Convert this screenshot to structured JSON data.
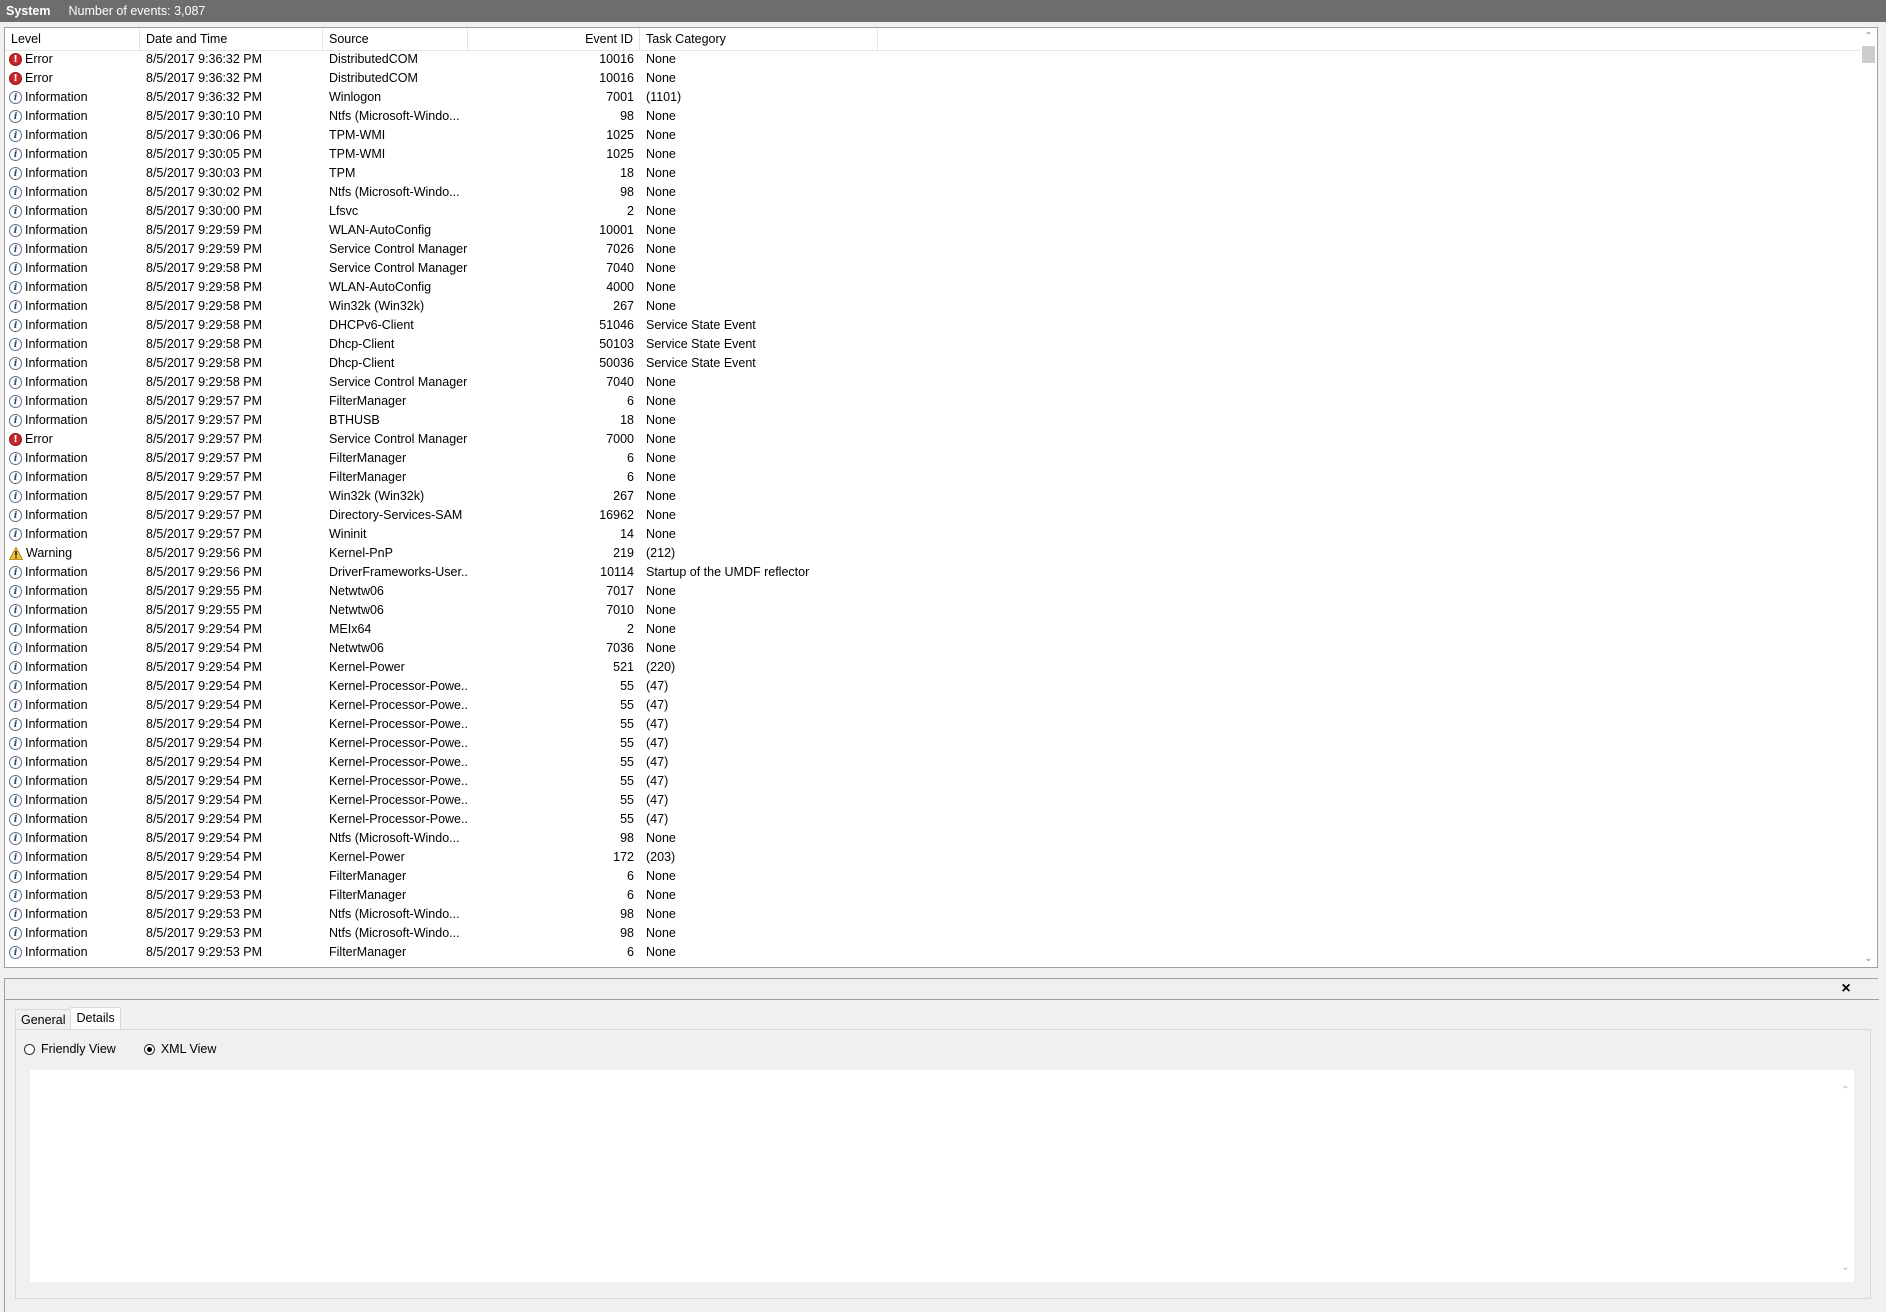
{
  "titlebar": {
    "title": "System",
    "count_text": "Number of events: 3,087"
  },
  "columns": {
    "level": "Level",
    "date": "Date and Time",
    "source": "Source",
    "event_id": "Event ID",
    "category": "Task Category"
  },
  "events": [
    {
      "level": "Error",
      "date": "8/5/2017 9:36:32 PM",
      "source": "DistributedCOM",
      "event_id": "10016",
      "category": "None"
    },
    {
      "level": "Error",
      "date": "8/5/2017 9:36:32 PM",
      "source": "DistributedCOM",
      "event_id": "10016",
      "category": "None"
    },
    {
      "level": "Information",
      "date": "8/5/2017 9:36:32 PM",
      "source": "Winlogon",
      "event_id": "7001",
      "category": "(1101)"
    },
    {
      "level": "Information",
      "date": "8/5/2017 9:30:10 PM",
      "source": "Ntfs (Microsoft-Windo...",
      "event_id": "98",
      "category": "None"
    },
    {
      "level": "Information",
      "date": "8/5/2017 9:30:06 PM",
      "source": "TPM-WMI",
      "event_id": "1025",
      "category": "None"
    },
    {
      "level": "Information",
      "date": "8/5/2017 9:30:05 PM",
      "source": "TPM-WMI",
      "event_id": "1025",
      "category": "None"
    },
    {
      "level": "Information",
      "date": "8/5/2017 9:30:03 PM",
      "source": "TPM",
      "event_id": "18",
      "category": "None"
    },
    {
      "level": "Information",
      "date": "8/5/2017 9:30:02 PM",
      "source": "Ntfs (Microsoft-Windo...",
      "event_id": "98",
      "category": "None"
    },
    {
      "level": "Information",
      "date": "8/5/2017 9:30:00 PM",
      "source": "Lfsvc",
      "event_id": "2",
      "category": "None"
    },
    {
      "level": "Information",
      "date": "8/5/2017 9:29:59 PM",
      "source": "WLAN-AutoConfig",
      "event_id": "10001",
      "category": "None"
    },
    {
      "level": "Information",
      "date": "8/5/2017 9:29:59 PM",
      "source": "Service Control Manager",
      "event_id": "7026",
      "category": "None"
    },
    {
      "level": "Information",
      "date": "8/5/2017 9:29:58 PM",
      "source": "Service Control Manager",
      "event_id": "7040",
      "category": "None"
    },
    {
      "level": "Information",
      "date": "8/5/2017 9:29:58 PM",
      "source": "WLAN-AutoConfig",
      "event_id": "4000",
      "category": "None"
    },
    {
      "level": "Information",
      "date": "8/5/2017 9:29:58 PM",
      "source": "Win32k (Win32k)",
      "event_id": "267",
      "category": "None"
    },
    {
      "level": "Information",
      "date": "8/5/2017 9:29:58 PM",
      "source": "DHCPv6-Client",
      "event_id": "51046",
      "category": "Service State Event"
    },
    {
      "level": "Information",
      "date": "8/5/2017 9:29:58 PM",
      "source": "Dhcp-Client",
      "event_id": "50103",
      "category": "Service State Event"
    },
    {
      "level": "Information",
      "date": "8/5/2017 9:29:58 PM",
      "source": "Dhcp-Client",
      "event_id": "50036",
      "category": "Service State Event"
    },
    {
      "level": "Information",
      "date": "8/5/2017 9:29:58 PM",
      "source": "Service Control Manager",
      "event_id": "7040",
      "category": "None"
    },
    {
      "level": "Information",
      "date": "8/5/2017 9:29:57 PM",
      "source": "FilterManager",
      "event_id": "6",
      "category": "None"
    },
    {
      "level": "Information",
      "date": "8/5/2017 9:29:57 PM",
      "source": "BTHUSB",
      "event_id": "18",
      "category": "None"
    },
    {
      "level": "Error",
      "date": "8/5/2017 9:29:57 PM",
      "source": "Service Control Manager",
      "event_id": "7000",
      "category": "None"
    },
    {
      "level": "Information",
      "date": "8/5/2017 9:29:57 PM",
      "source": "FilterManager",
      "event_id": "6",
      "category": "None"
    },
    {
      "level": "Information",
      "date": "8/5/2017 9:29:57 PM",
      "source": "FilterManager",
      "event_id": "6",
      "category": "None"
    },
    {
      "level": "Information",
      "date": "8/5/2017 9:29:57 PM",
      "source": "Win32k (Win32k)",
      "event_id": "267",
      "category": "None"
    },
    {
      "level": "Information",
      "date": "8/5/2017 9:29:57 PM",
      "source": "Directory-Services-SAM",
      "event_id": "16962",
      "category": "None"
    },
    {
      "level": "Information",
      "date": "8/5/2017 9:29:57 PM",
      "source": "Wininit",
      "event_id": "14",
      "category": "None"
    },
    {
      "level": "Warning",
      "date": "8/5/2017 9:29:56 PM",
      "source": "Kernel-PnP",
      "event_id": "219",
      "category": "(212)"
    },
    {
      "level": "Information",
      "date": "8/5/2017 9:29:56 PM",
      "source": "DriverFrameworks-User...",
      "event_id": "10114",
      "category": "Startup of the UMDF reflector"
    },
    {
      "level": "Information",
      "date": "8/5/2017 9:29:55 PM",
      "source": "Netwtw06",
      "event_id": "7017",
      "category": "None"
    },
    {
      "level": "Information",
      "date": "8/5/2017 9:29:55 PM",
      "source": "Netwtw06",
      "event_id": "7010",
      "category": "None"
    },
    {
      "level": "Information",
      "date": "8/5/2017 9:29:54 PM",
      "source": "MEIx64",
      "event_id": "2",
      "category": "None"
    },
    {
      "level": "Information",
      "date": "8/5/2017 9:29:54 PM",
      "source": "Netwtw06",
      "event_id": "7036",
      "category": "None"
    },
    {
      "level": "Information",
      "date": "8/5/2017 9:29:54 PM",
      "source": "Kernel-Power",
      "event_id": "521",
      "category": "(220)"
    },
    {
      "level": "Information",
      "date": "8/5/2017 9:29:54 PM",
      "source": "Kernel-Processor-Powe...",
      "event_id": "55",
      "category": "(47)"
    },
    {
      "level": "Information",
      "date": "8/5/2017 9:29:54 PM",
      "source": "Kernel-Processor-Powe...",
      "event_id": "55",
      "category": "(47)"
    },
    {
      "level": "Information",
      "date": "8/5/2017 9:29:54 PM",
      "source": "Kernel-Processor-Powe...",
      "event_id": "55",
      "category": "(47)"
    },
    {
      "level": "Information",
      "date": "8/5/2017 9:29:54 PM",
      "source": "Kernel-Processor-Powe...",
      "event_id": "55",
      "category": "(47)"
    },
    {
      "level": "Information",
      "date": "8/5/2017 9:29:54 PM",
      "source": "Kernel-Processor-Powe...",
      "event_id": "55",
      "category": "(47)"
    },
    {
      "level": "Information",
      "date": "8/5/2017 9:29:54 PM",
      "source": "Kernel-Processor-Powe...",
      "event_id": "55",
      "category": "(47)"
    },
    {
      "level": "Information",
      "date": "8/5/2017 9:29:54 PM",
      "source": "Kernel-Processor-Powe...",
      "event_id": "55",
      "category": "(47)"
    },
    {
      "level": "Information",
      "date": "8/5/2017 9:29:54 PM",
      "source": "Kernel-Processor-Powe...",
      "event_id": "55",
      "category": "(47)"
    },
    {
      "level": "Information",
      "date": "8/5/2017 9:29:54 PM",
      "source": "Ntfs (Microsoft-Windo...",
      "event_id": "98",
      "category": "None"
    },
    {
      "level": "Information",
      "date": "8/5/2017 9:29:54 PM",
      "source": "Kernel-Power",
      "event_id": "172",
      "category": "(203)"
    },
    {
      "level": "Information",
      "date": "8/5/2017 9:29:54 PM",
      "source": "FilterManager",
      "event_id": "6",
      "category": "None"
    },
    {
      "level": "Information",
      "date": "8/5/2017 9:29:53 PM",
      "source": "FilterManager",
      "event_id": "6",
      "category": "None"
    },
    {
      "level": "Information",
      "date": "8/5/2017 9:29:53 PM",
      "source": "Ntfs (Microsoft-Windo...",
      "event_id": "98",
      "category": "None"
    },
    {
      "level": "Information",
      "date": "8/5/2017 9:29:53 PM",
      "source": "Ntfs (Microsoft-Windo...",
      "event_id": "98",
      "category": "None"
    },
    {
      "level": "Information",
      "date": "8/5/2017 9:29:53 PM",
      "source": "FilterManager",
      "event_id": "6",
      "category": "None"
    }
  ],
  "icons": {
    "Error": "error-icon",
    "Information": "information-icon",
    "Warning": "warning-icon"
  },
  "details": {
    "close_label": "×",
    "tabs": [
      "General",
      "Details"
    ],
    "active_tab": "Details",
    "friendly_view": "Friendly View",
    "xml_view": "XML View",
    "selected_view": "XML View"
  },
  "scrollbar": {
    "up_arrow": "▲",
    "down_arrow": "▼"
  }
}
